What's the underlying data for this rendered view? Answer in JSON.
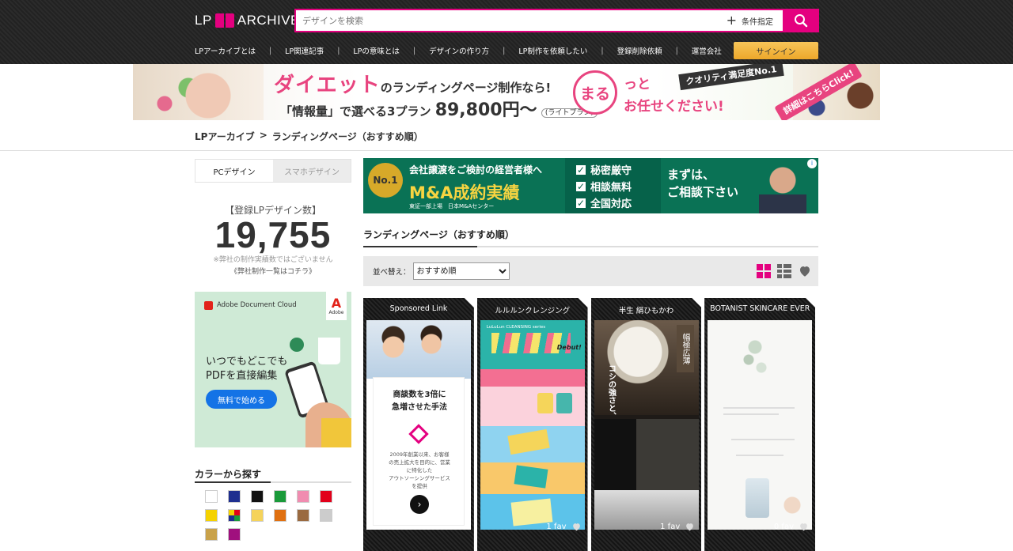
{
  "header": {
    "logo_left": "LP",
    "logo_right": "ARCHIVE",
    "search_placeholder": "デザインを検索",
    "condition_label": "条件指定",
    "nav": [
      "LPアーカイブとは",
      "LP関連記事",
      "LPの意味とは",
      "デザインの作り方",
      "LP制作を依頼したい",
      "登録削除依頼",
      "運営会社"
    ],
    "signin_label": "サインイン"
  },
  "banner": {
    "line1_main": "ダイエット",
    "line1_rest": "のランディングページ制作なら!",
    "line2": "「情報量」で選べる3プラン",
    "price": "89,800円〜",
    "plan": "(ライトプラン)",
    "maru": "まる",
    "line3a": "っと",
    "line3b": "お任せください!",
    "no1": "クオリティ満足度No.1",
    "click": "詳細はこちらClick!"
  },
  "breadcrumb": {
    "root": "LPアーカイブ",
    "sep": ">",
    "current": "ランディングページ（おすすめ順）"
  },
  "sidebar": {
    "tabs": [
      "PCデザイン",
      "スマホデザイン"
    ],
    "count_label": "【登録LPデザイン数】",
    "count": "19,755",
    "count_note": "※弊社の制作実績数ではございません",
    "count_link": "《弊社制作一覧はコチラ》",
    "ad": {
      "brand": "Adobe Document Cloud",
      "mark": "Adobe",
      "text1": "いつでもどこでも",
      "text2": "PDFを直接編集",
      "button": "無料で始める"
    },
    "color_title": "カラーから探す",
    "colors": [
      "#ffffff",
      "#1f2f8f",
      "#111111",
      "#1a9a3a",
      "#f08cb0",
      "#e2001a",
      "#f5d200",
      "multi",
      "#f5d35a",
      "#e07010",
      "#9a6a40",
      "#cccccc",
      "#c9a24a",
      "#a0107e"
    ]
  },
  "main": {
    "ad": {
      "badge": "No.1",
      "line1": "会社譲渡をご検討の経営者様へ",
      "line2": "M&A成約実績",
      "line3": "東証一部上場　日本M&Aセンター",
      "checks": [
        "秘密厳守",
        "相談無料",
        "全国対応"
      ],
      "cta1": "まずは、",
      "cta2": "ご相談下さい",
      "info": "i"
    },
    "section_title": "ランディングページ（おすすめ順）",
    "sort_label": "並べ替え：",
    "sort_options": [
      "おすすめ順"
    ],
    "sort_selected": "おすすめ順",
    "cards": [
      {
        "title": "Sponsored Link",
        "fav": ""
      },
      {
        "title": "ルルルンクレンジング",
        "fav": "1 fav"
      },
      {
        "title": "半生 絹ひもかわ",
        "fav": "1 fav"
      },
      {
        "title": "BOTANIST SKINCARE EVER",
        "fav": "0 fav"
      }
    ],
    "sponsored": {
      "heading1": "商談数を3倍に",
      "heading2": "急増させた手法",
      "p1": "2009年創業以来、お客様",
      "p2": "の売上拡大を目的に、営業",
      "p3": "に特化した",
      "p4": "アウトソーシングサービス",
      "p5": "を提供"
    },
    "card2": {
      "banner": "LuLuLun CLEANSING series",
      "debut": "Debut!"
    },
    "card3": {
      "kanji": "幅極広薄",
      "copy": "コシの強さと、絶品の喉越し。"
    }
  }
}
